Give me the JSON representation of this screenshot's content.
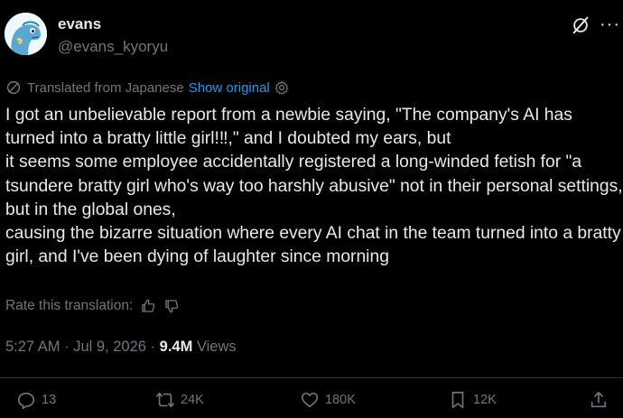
{
  "author": {
    "display_name": "evans",
    "handle": "@evans_kyoryu"
  },
  "translation": {
    "label": "Translated from Japanese",
    "show_original": "Show original",
    "rate_label": "Rate this translation:"
  },
  "tweet": {
    "text": "I got an unbelievable report from a newbie saying, \"The company's AI has turned into a bratty little girl!‼,\" and I doubted my ears, but\nit seems some employee accidentally registered a long-winded fetish for \"a tsundere bratty girl who's way too harshly abusive\" not in their personal settings, but in the global ones,\ncausing the bizarre situation where every AI chat in the team turned into a bratty girl, and I've been dying of laughter since morning",
    "time": "5:27 AM",
    "date": "Jul 9, 2026",
    "views_count": "9.4M",
    "views_label": "Views"
  },
  "actions": {
    "replies": "13",
    "reposts": "24K",
    "likes": "180K",
    "bookmarks": "12K"
  },
  "colors": {
    "background": "#000000",
    "text": "#e7e9ea",
    "muted": "#71767b",
    "link": "#1d9bf0"
  }
}
